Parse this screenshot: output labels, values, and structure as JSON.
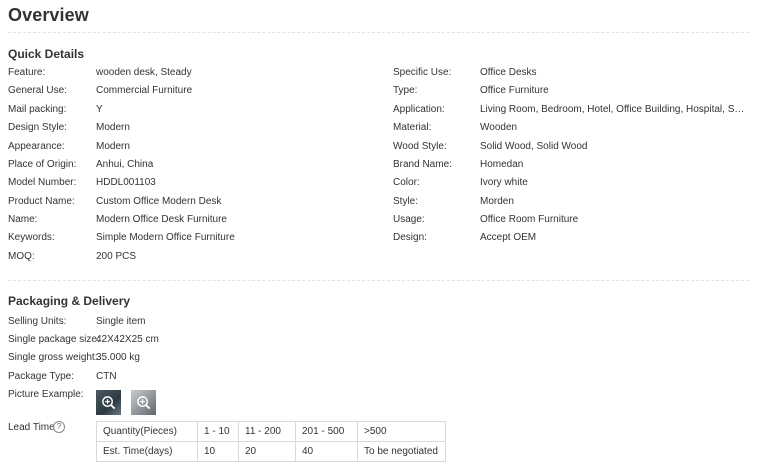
{
  "page_title": "Overview",
  "quick_details": {
    "title": "Quick Details",
    "left": [
      {
        "label": "Feature:",
        "value": "wooden desk, Steady"
      },
      {
        "label": "General Use:",
        "value": "Commercial Furniture"
      },
      {
        "label": "Mail packing:",
        "value": "Y"
      },
      {
        "label": "Design Style:",
        "value": "Modern"
      },
      {
        "label": "Appearance:",
        "value": "Modern"
      },
      {
        "label": "Place of Origin:",
        "value": "Anhui, China"
      },
      {
        "label": "Model Number:",
        "value": "HDDL001103"
      },
      {
        "label": "Product Name:",
        "value": "Custom Office Modern Desk"
      },
      {
        "label": "Name:",
        "value": "Modern Office Desk Furniture"
      },
      {
        "label": "Keywords:",
        "value": "Simple Modern Office Furniture"
      },
      {
        "label": "MOQ:",
        "value": "200 PCS"
      }
    ],
    "right": [
      {
        "label": "Specific Use:",
        "value": "Office Desks"
      },
      {
        "label": "Type:",
        "value": "Office Furniture"
      },
      {
        "label": "Application:",
        "value": "Living Room, Bedroom, Hotel, Office Building, Hospital, School..."
      },
      {
        "label": "Material:",
        "value": "Wooden"
      },
      {
        "label": "Wood Style:",
        "value": "Solid Wood, Solid Wood"
      },
      {
        "label": "Brand Name:",
        "value": "Homedan"
      },
      {
        "label": "Color:",
        "value": "Ivory white"
      },
      {
        "label": "Style:",
        "value": "Morden"
      },
      {
        "label": "Usage:",
        "value": "Office Room Furniture"
      },
      {
        "label": "Design:",
        "value": "Accept OEM"
      }
    ]
  },
  "packaging": {
    "title": "Packaging & Delivery",
    "rows": [
      {
        "label": "Selling Units:",
        "value": "Single item"
      },
      {
        "label": "Single package size:",
        "value": "42X42X25 cm"
      },
      {
        "label": "Single gross weight:",
        "value": "35.000 kg"
      },
      {
        "label": "Package Type:",
        "value": "CTN"
      }
    ],
    "picture_label": "Picture Example:",
    "thumbnail_icon": "zoom-in-icon",
    "lead_time_label": "Lead Time",
    "help_icon": "?",
    "lead_table": {
      "header": [
        "Quantity(Pieces)",
        "1 - 10",
        "11 - 200",
        "201 - 500",
        ">500"
      ],
      "row": [
        "Est. Time(days)",
        "10",
        "20",
        "40",
        "To be negotiated"
      ]
    }
  }
}
